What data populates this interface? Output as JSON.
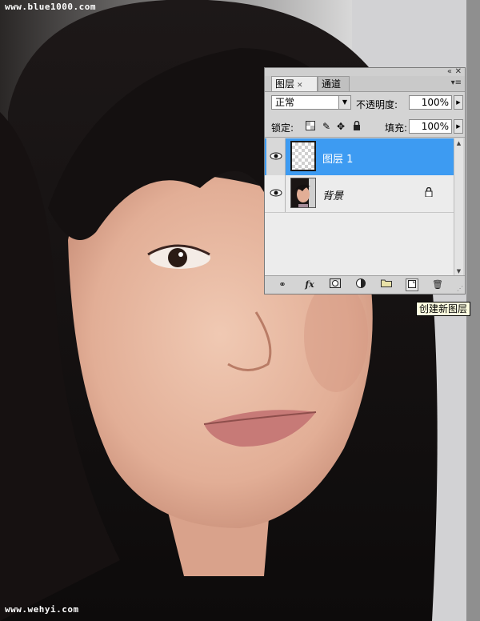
{
  "watermarks": {
    "top": "www.blue1000.com",
    "bottom": "www.wehyi.com"
  },
  "panel": {
    "tabs": [
      {
        "label": "图层",
        "active": true
      },
      {
        "label": "通道",
        "active": false
      }
    ],
    "blend_mode": "正常",
    "opacity_label": "不透明度:",
    "opacity_value": "100%",
    "lock_label": "锁定:",
    "fill_label": "填充:",
    "fill_value": "100%",
    "layers": [
      {
        "name": "图层 1",
        "visible": true,
        "selected": true,
        "thumbnail": "transparent",
        "locked": false
      },
      {
        "name": "背景",
        "visible": true,
        "selected": false,
        "thumbnail": "portrait",
        "locked": true
      }
    ],
    "footer_icons": [
      "link-icon",
      "fx-icon",
      "mask-icon",
      "adjustment-icon",
      "folder-icon",
      "new-layer-icon",
      "trash-icon"
    ]
  },
  "tooltip": "创建新图层",
  "colors": {
    "selection": "#3d9bf2",
    "panel_bg": "#d4d4d4",
    "tooltip_bg": "#ffffe1"
  }
}
